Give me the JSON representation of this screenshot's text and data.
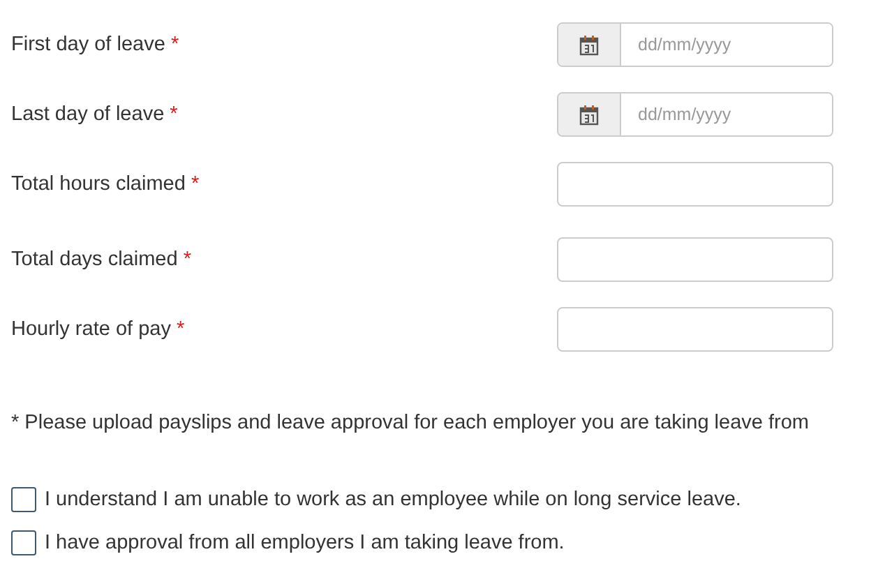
{
  "fields": [
    {
      "label": "First day of leave",
      "required_mark": "*",
      "kind": "date",
      "placeholder": "dd/mm/yyyy"
    },
    {
      "label": "Last day of leave",
      "required_mark": "*",
      "kind": "date",
      "placeholder": "dd/mm/yyyy"
    },
    {
      "label": "Total hours claimed",
      "required_mark": "*",
      "kind": "text"
    },
    {
      "label": "Total days claimed",
      "required_mark": "*",
      "kind": "text"
    },
    {
      "label": "Hourly rate of pay",
      "required_mark": "*",
      "kind": "text"
    }
  ],
  "note": "* Please upload payslips and leave approval for each employer you are taking leave from",
  "declarations": [
    {
      "label": "I understand I am unable to work as an employee while on long service leave.",
      "checked": false
    },
    {
      "label": "I have approval from all employers I am taking leave from.",
      "checked": false
    }
  ]
}
